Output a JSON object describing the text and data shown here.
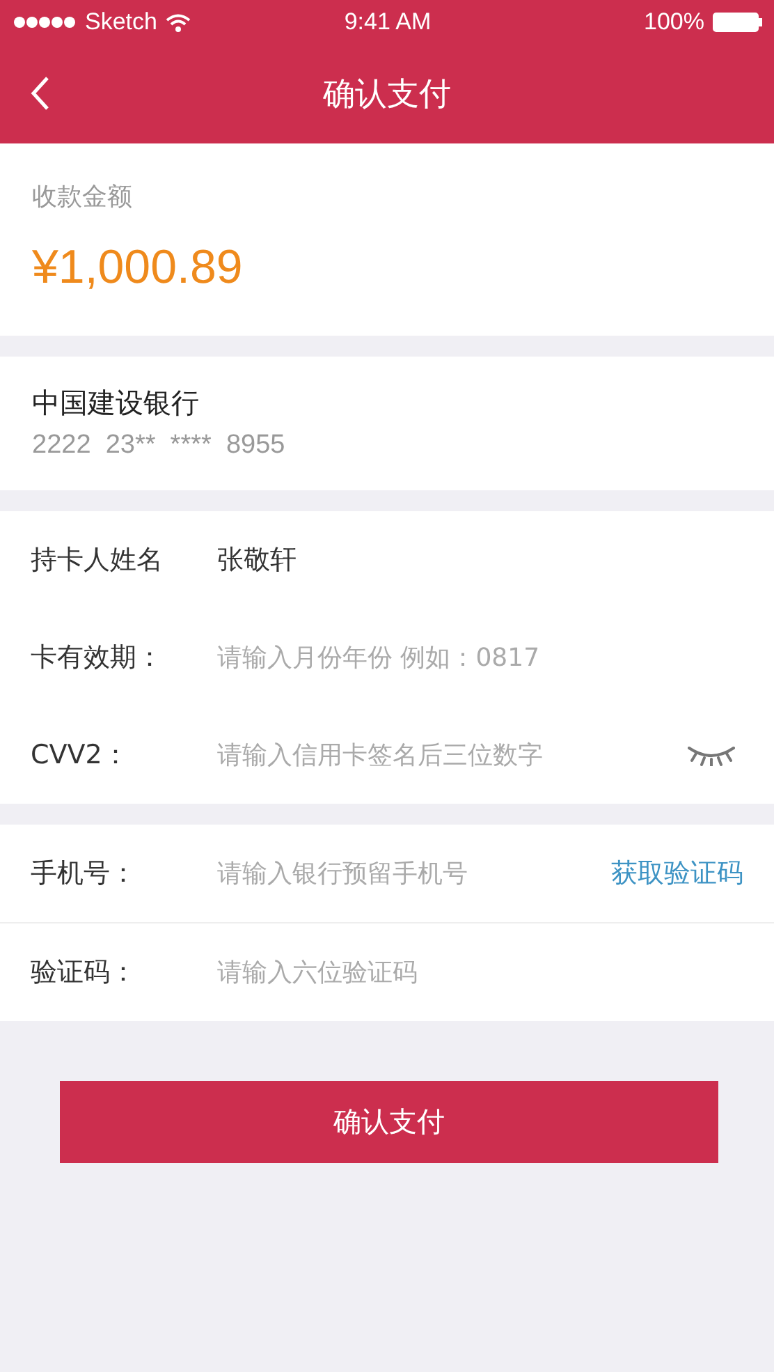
{
  "status_bar": {
    "carrier": "Sketch",
    "time": "9:41 AM",
    "battery": "100%"
  },
  "nav": {
    "title": "确认支付"
  },
  "amount": {
    "label": "收款金额",
    "value": "¥1,000.89"
  },
  "card": {
    "bank": "中国建设银行",
    "number": "2222  23**  ****  8955"
  },
  "card_fields": [
    {
      "kind": "value",
      "label": "持卡人姓名",
      "value": "张敬轩"
    },
    {
      "kind": "input",
      "label": "卡有效期：",
      "placeholder": "请输入月份年份 例如：0817"
    },
    {
      "kind": "secret",
      "label": "CVV2：",
      "placeholder": "请输入信用卡签名后三位数字"
    }
  ],
  "verify_fields": [
    {
      "kind": "action",
      "label": "手机号：",
      "placeholder": "请输入银行预留手机号",
      "action": "获取验证码"
    },
    {
      "kind": "input",
      "label": "验证码：",
      "placeholder": "请输入六位验证码"
    }
  ],
  "submit": "确认支付"
}
